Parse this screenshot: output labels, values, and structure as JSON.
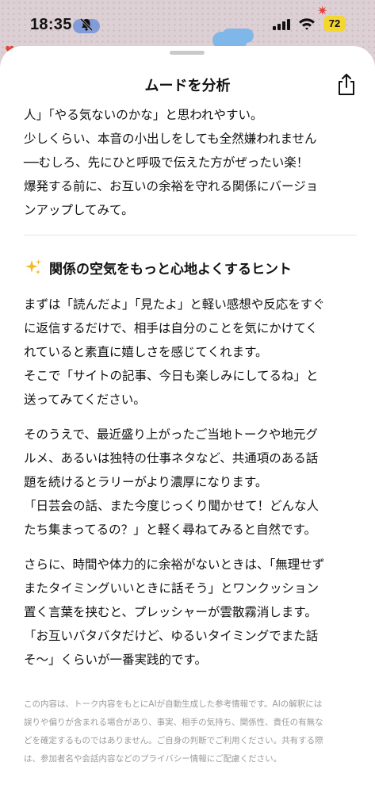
{
  "status_bar": {
    "time": "18:35",
    "battery": "72",
    "icons": [
      "bell-slash-icon",
      "signal-icon",
      "wifi-icon"
    ]
  },
  "sheet": {
    "title": "ムードを分析",
    "share_icon": "share-icon"
  },
  "content": {
    "intro": "人」「やる気ないのかな」と思われやすい。\n少しくらい、本音の小出しをしても全然嫌われません\n──むしろ、先にひと呼吸で伝えた方がぜったい楽！\n爆発する前に、お互いの余裕を守れる関係にバージョ\nンアップしてみて。",
    "hint_icon": "sparkles-icon",
    "hint_title": "関係の空気をもっと心地よくするヒント",
    "paragraphs": [
      "まずは「読んだよ」「見たよ」と軽い感想や反応をすぐ\nに返信するだけで、相手は自分のことを気にかけてく\nれていると素直に嬉しさを感じてくれます。\nそこで「サイトの記事、今日も楽しみにしてるね」と\n送ってみてください。",
      "そのうえで、最近盛り上がったご当地トークや地元グ\nルメ、あるいは独特の仕事ネタなど、共通項のある話\n題を続けるとラリーがより濃厚になります。\n「日芸会の話、また今度じっくり聞かせて！どんな人\nたち集まってるの？」と軽く尋ねてみると自然です。",
      "さらに、時間や体力的に余裕がないときは、「無理せず\nまたタイミングいいときに話そう」とワンクッション\n置く言葉を挟むと、プレッシャーが雲散霧消します。\n「お互いバタバタだけど、ゆるいタイミングでまた話\nそ〜」くらいが一番実践的です。"
    ],
    "disclaimer": "この内容は、トーク内容をもとにAIが自動生成した参考情報です。AIの解釈には\n誤りや偏りが含まれる場合があり、事実、相手の気持ち、関係性、責任の有無な\nどを確定するものではありません。ご自身の判断でご利用ください。共有する際\nは、参加者名や会話内容などのプライバシー情報にご配慮ください。"
  },
  "colors": {
    "sheet_background": "#ffffff",
    "text": "#111111",
    "disclaimer_text": "#9a9a9a",
    "battery_fill": "#f5d630"
  }
}
